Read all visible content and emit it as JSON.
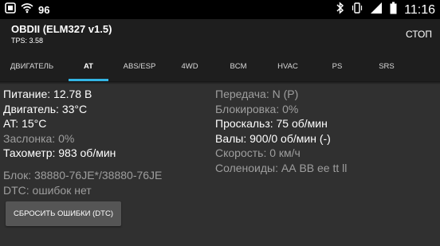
{
  "status_bar": {
    "notification_count": "96",
    "time": "11:16",
    "icons": [
      "notification-icon",
      "wifi-icon",
      "bluetooth-icon",
      "vibrate-icon",
      "signal-icon",
      "battery-icon"
    ]
  },
  "action_bar": {
    "title": "OBDII (ELM327 v1.5)",
    "subtitle": "TPS: 3.58",
    "stop_label": "СТОП"
  },
  "tabs": [
    {
      "label": "ДВИГАТЕЛЬ",
      "active": false
    },
    {
      "label": "AT",
      "active": true
    },
    {
      "label": "ABS/ESP",
      "active": false
    },
    {
      "label": "4WD",
      "active": false
    },
    {
      "label": "BCM",
      "active": false
    },
    {
      "label": "HVAC",
      "active": false
    },
    {
      "label": "PS",
      "active": false
    },
    {
      "label": "SRS",
      "active": false
    }
  ],
  "left_values": [
    "Питание: 12.78 В",
    "Двигатель: 33°C",
    "AT: 15°C",
    "Заслонка: 0%",
    "Тахометр: 983 об/мин"
  ],
  "right_values": [
    "Передача: N (P)",
    "Блокировка: 0%",
    "Проскальз: 75 об/мин",
    "Валы: 900/0 об/мин (-)",
    "Скорость: 0 км/ч",
    "Соленоиды: АА ВВ ее tt ll"
  ],
  "block_info": "Блок: 38880-76JE*/38880-76JE",
  "dtc_info": "DTC: ошибок нет",
  "reset_button_label": "СБРОСИТЬ ОШИБКИ (DTC)",
  "colors": {
    "background": "#303030",
    "bar": "#1e1e1e",
    "accent": "#33b5e5",
    "dim_text": "#9e9e9e",
    "button": "#555555"
  }
}
